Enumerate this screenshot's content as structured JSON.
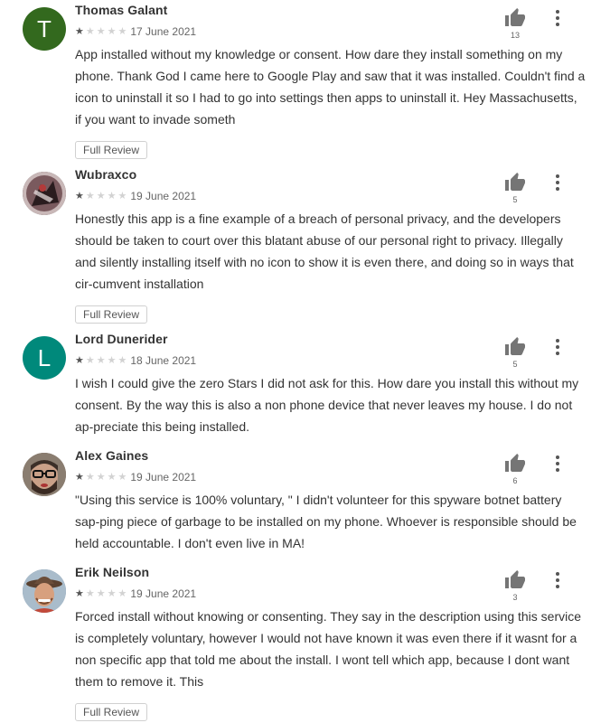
{
  "full_review_label": "Full Review",
  "colors": {
    "star_on": "#555555",
    "star_off": "#d2d2d2",
    "thumb": "#757575"
  },
  "reviews": [
    {
      "author": "Thomas Galant",
      "avatar": {
        "type": "letter",
        "letter": "T",
        "color": "#33691e"
      },
      "rating": 1,
      "max_rating": 5,
      "date": "17 June 2021",
      "text": "App installed without my knowledge or consent. How dare they install something on my phone. Thank God I came here to Google Play and saw that it was installed. Couldn't find a icon to uninstall it so I had to go into settings then apps to uninstall it. Hey Massachusetts, if you want to invade someth",
      "helpful_count": "13",
      "has_full_review": true
    },
    {
      "author": "Wubraxco",
      "avatar": {
        "type": "photo",
        "icon": "dark-figure-photo"
      },
      "rating": 1,
      "max_rating": 5,
      "date": "19 June 2021",
      "text": "Honestly this app is a fine example of a breach of personal privacy, and the developers should be taken to court over this blatant abuse of our personal right to privacy. Illegally and silently installing itself with no icon to show it is even there, and doing so in ways that cir-cumvent installation",
      "helpful_count": "5",
      "has_full_review": true
    },
    {
      "author": "Lord Dunerider",
      "avatar": {
        "type": "letter",
        "letter": "L",
        "color": "#00897b"
      },
      "rating": 1,
      "max_rating": 5,
      "date": "18 June 2021",
      "text": "I wish I could give the zero Stars I did not ask for this. How dare you install this without my consent. By the way this is also a non phone device that never leaves my house. I do not ap-preciate this being installed.",
      "helpful_count": "5",
      "has_full_review": false
    },
    {
      "author": "Alex Gaines",
      "avatar": {
        "type": "photo",
        "icon": "bearded-man-glasses-photo"
      },
      "rating": 1,
      "max_rating": 5,
      "date": "19 June 2021",
      "text": "\"Using this service is 100% voluntary, \" I didn't volunteer for this spyware botnet battery sap-ping piece of garbage to be installed on my phone. Whoever is responsible should be held accountable. I don't even live in MA!",
      "helpful_count": "6",
      "has_full_review": false
    },
    {
      "author": "Erik Neilson",
      "avatar": {
        "type": "photo",
        "icon": "man-cowboy-hat-photo"
      },
      "rating": 1,
      "max_rating": 5,
      "date": "19 June 2021",
      "text": "Forced install without knowing or consenting. They say in the description using this service is completely voluntary, however I would not have known it was even there if it wasnt for a non specific app that told me about the install. I wont tell which app, because I dont want them to remove it. This",
      "helpful_count": "3",
      "has_full_review": true
    }
  ]
}
